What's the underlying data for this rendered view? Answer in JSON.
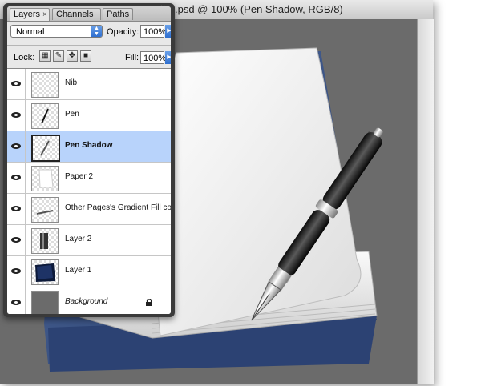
{
  "document": {
    "title": ".psd @ 100% (Pen Shadow, RGB/8)"
  },
  "palette": {
    "tabs": [
      {
        "label": "Layers",
        "active": true
      },
      {
        "label": "Channels",
        "active": false
      },
      {
        "label": "Paths",
        "active": false
      }
    ],
    "tab_close": "×",
    "close": "×",
    "blend_mode": "Normal",
    "opacity_label": "Opacity:",
    "opacity_value": "100%",
    "lock_label": "Lock:",
    "fill_label": "Fill:",
    "fill_value": "100%",
    "layers": [
      {
        "name": "Nib",
        "selected": false,
        "italic": false,
        "locked": false
      },
      {
        "name": "Pen",
        "selected": false,
        "italic": false,
        "locked": false
      },
      {
        "name": "Pen Shadow",
        "selected": true,
        "italic": false,
        "locked": false
      },
      {
        "name": "Paper 2",
        "selected": false,
        "italic": false,
        "locked": false
      },
      {
        "name": "Other Pages's Gradient Fill co...",
        "selected": false,
        "italic": false,
        "locked": false
      },
      {
        "name": "Layer 2",
        "selected": false,
        "italic": false,
        "locked": false
      },
      {
        "name": "Layer 1",
        "selected": false,
        "italic": false,
        "locked": false
      },
      {
        "name": "Background",
        "selected": false,
        "italic": true,
        "locked": true
      }
    ]
  },
  "colors": {
    "canvas_bg": "#6b6b6b",
    "selection": "#b8d3fb",
    "book_blue": "#3c5690"
  }
}
